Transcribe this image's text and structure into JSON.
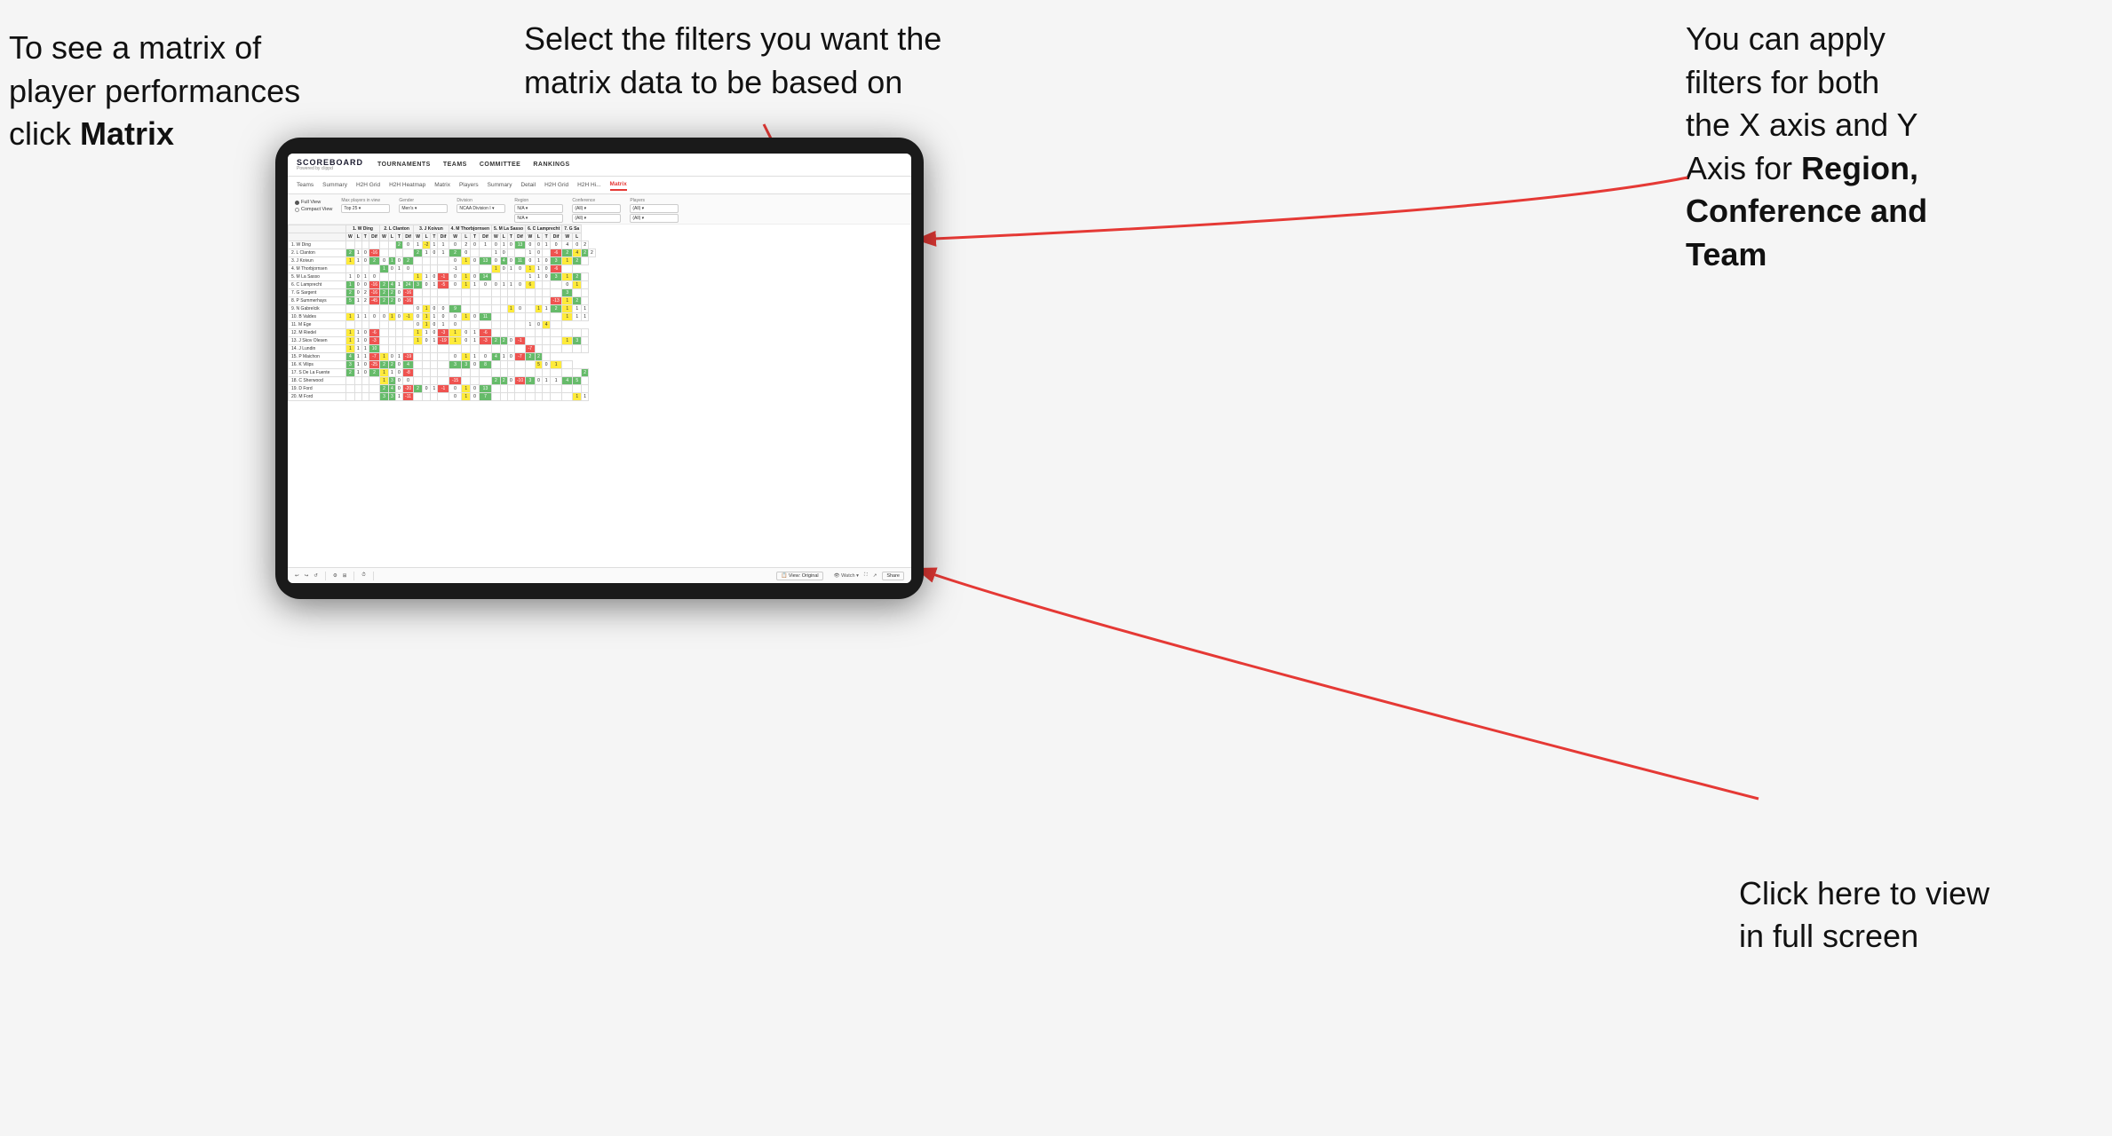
{
  "annotations": {
    "top_left": {
      "line1": "To see a matrix of",
      "line2": "player performances",
      "line3_prefix": "click ",
      "line3_bold": "Matrix"
    },
    "top_center": {
      "text": "Select the filters you want the matrix data to be based on"
    },
    "top_right": {
      "line1": "You  can apply",
      "line2": "filters for both",
      "line3": "the X axis and Y",
      "line4_prefix": "Axis for ",
      "line4_bold": "Region,",
      "line5_bold": "Conference and",
      "line6_bold": "Team"
    },
    "bottom_right": {
      "line1": "Click here to view",
      "line2": "in full screen"
    }
  },
  "app": {
    "logo": "SCOREBOARD",
    "logo_sub": "Powered by clippd",
    "nav": [
      "TOURNAMENTS",
      "TEAMS",
      "COMMITTEE",
      "RANKINGS"
    ],
    "subnav": [
      "Teams",
      "Summary",
      "H2H Grid",
      "H2H Heatmap",
      "Matrix",
      "Players",
      "Summary",
      "Detail",
      "H2H Grid",
      "H2H Hi...",
      "Matrix"
    ],
    "active_subnav": "Matrix"
  },
  "filters": {
    "view_options": [
      "Full View",
      "Compact View"
    ],
    "active_view": "Full View",
    "max_players_label": "Max players in view",
    "max_players_value": "Top 25",
    "gender_label": "Gender",
    "gender_value": "Men's",
    "division_label": "Division",
    "division_value": "NCAA Division I",
    "region_label": "Region",
    "region_values": [
      "N/A",
      "N/A"
    ],
    "conference_label": "Conference",
    "conference_values": [
      "(All)",
      "(All)"
    ],
    "players_label": "Players",
    "players_values": [
      "(All)",
      "(All)"
    ]
  },
  "column_headers": [
    "1. W Ding",
    "2. L Clanton",
    "3. J Koivun",
    "4. M Thorbjornsen",
    "5. M La Sasso",
    "6. C Lamprecht",
    "7. G Sa"
  ],
  "sub_headers": [
    "W",
    "L",
    "T",
    "Dif"
  ],
  "players": [
    "1. W Ding",
    "2. L Clanton",
    "3. J Koivun",
    "4. M Thorbjornsen",
    "5. M La Sasso",
    "6. C Lamprecht",
    "7. G Sargent",
    "8. P Summerhays",
    "9. N Gabrelcik",
    "10. B Valdes",
    "11. M Ege",
    "12. M Riedel",
    "13. J Skov Olesen",
    "14. J Lundin",
    "15. P Maichon",
    "16. K Vilips",
    "17. S De La Fuente",
    "18. C Sherwood",
    "19. D Ford",
    "20. M Ford"
  ],
  "toolbar": {
    "view_label": "View: Original",
    "watch_label": "Watch",
    "share_label": "Share"
  }
}
